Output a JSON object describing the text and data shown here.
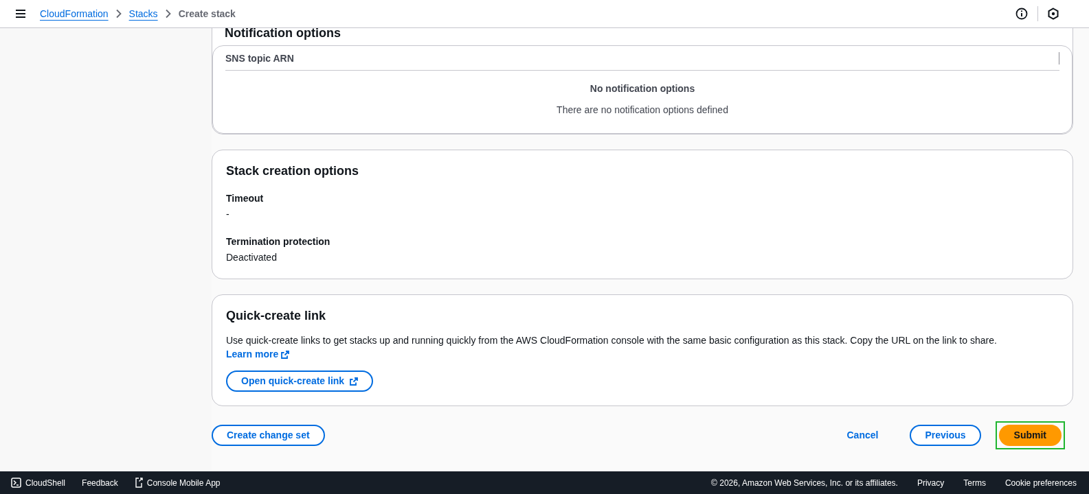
{
  "breadcrumbs": [
    {
      "label": "CloudFormation",
      "link": true
    },
    {
      "label": "Stacks",
      "link": true
    },
    {
      "label": "Create stack",
      "link": false
    }
  ],
  "notification_options": {
    "title": "Notification options",
    "column": "SNS topic ARN",
    "empty_title": "No notification options",
    "empty_text": "There are no notification options defined"
  },
  "stack_creation_options": {
    "title": "Stack creation options",
    "fields": [
      {
        "label": "Timeout",
        "value": "-"
      },
      {
        "label": "Termination protection",
        "value": "Deactivated"
      }
    ]
  },
  "quick_create_link": {
    "title": "Quick-create link",
    "description": "Use quick-create links to get stacks up and running quickly from the AWS CloudFormation console with the same basic configuration as this stack. Copy the URL on the link to share.",
    "learn_more": "Learn more",
    "button": "Open quick-create link"
  },
  "actions": {
    "left": [
      {
        "label": "Create change set",
        "kind": "normal",
        "highlighted": false
      }
    ],
    "right": [
      {
        "label": "Cancel",
        "kind": "link",
        "highlighted": false
      },
      {
        "label": "Previous",
        "kind": "normal",
        "highlighted": false
      },
      {
        "label": "Submit",
        "kind": "primary",
        "highlighted": true
      }
    ]
  },
  "footer": {
    "left": [
      "CloudShell",
      "Feedback",
      "Console Mobile App"
    ],
    "copyright": "© 2026, Amazon Web Services, Inc. or its affiliates.",
    "right": [
      "Privacy",
      "Terms",
      "Cookie preferences"
    ]
  }
}
